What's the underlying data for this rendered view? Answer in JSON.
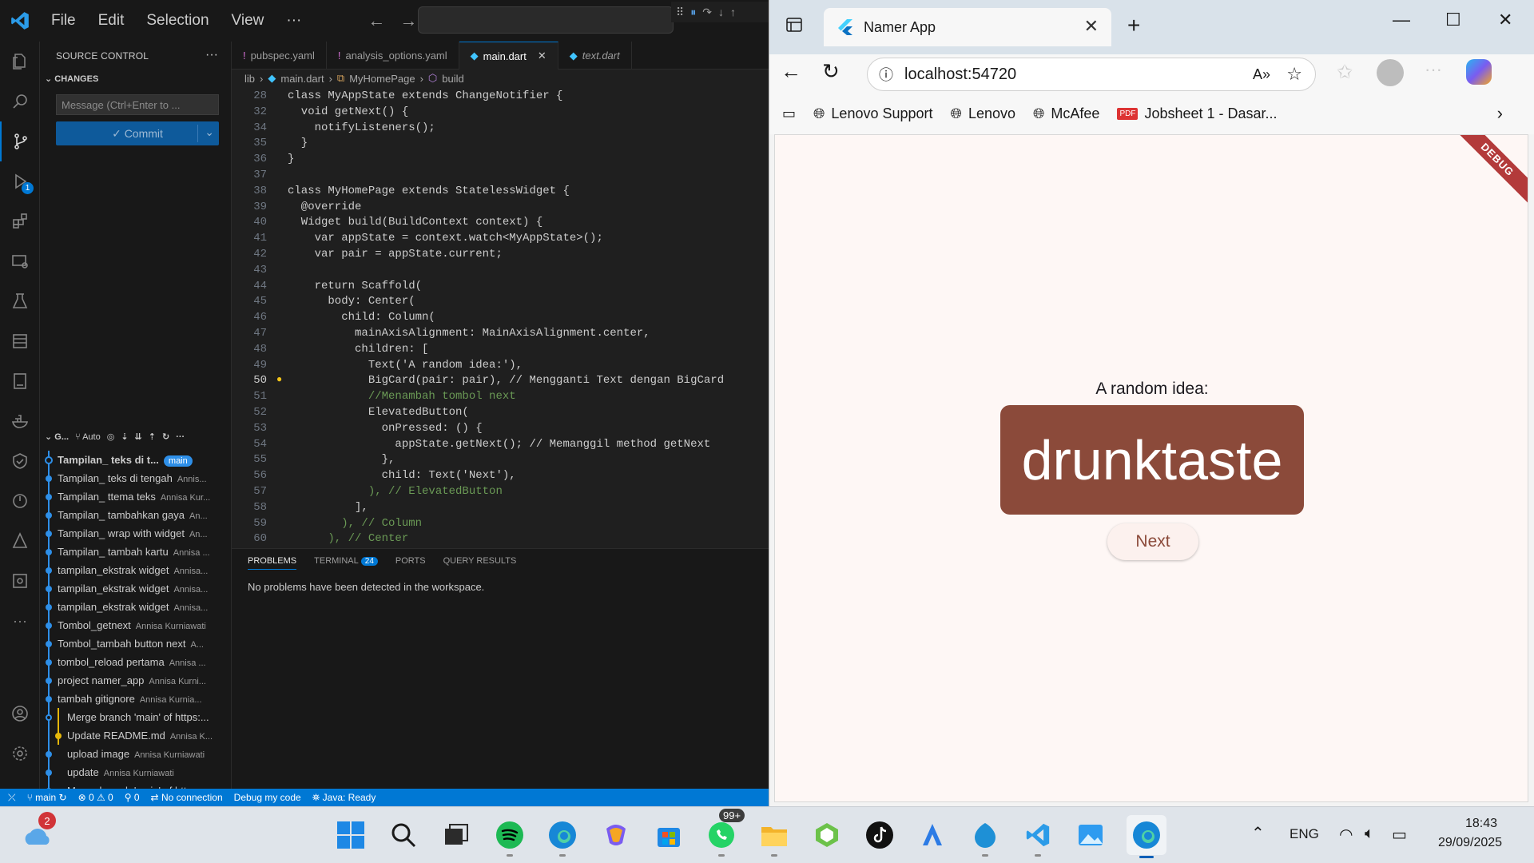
{
  "vscode": {
    "menu": [
      "File",
      "Edit",
      "Selection",
      "View",
      "···"
    ],
    "sidebar": {
      "title": "SOURCE CONTROL",
      "more": "···",
      "changes_header": "CHANGES",
      "commit_placeholder": "Message (Ctrl+Enter to ...",
      "commit_label": "✓ Commit",
      "graph_header": "G...",
      "graph_auto": "Auto",
      "branch_badge": "main",
      "commits": [
        {
          "msg": "Tampilan_ teks di t...",
          "author": ""
        },
        {
          "msg": "Tampilan_ teks di tengah",
          "author": "Annis..."
        },
        {
          "msg": "Tampilan_ ttema teks",
          "author": "Annisa Kur..."
        },
        {
          "msg": "Tampilan_ tambahkan gaya",
          "author": "An..."
        },
        {
          "msg": "Tampilan_ wrap with widget",
          "author": "An..."
        },
        {
          "msg": "Tampilan_ tambah kartu",
          "author": "Annisa ..."
        },
        {
          "msg": "tampilan_ekstrak widget",
          "author": "Annisa..."
        },
        {
          "msg": "tampilan_ekstrak widget",
          "author": "Annisa..."
        },
        {
          "msg": "tampilan_ekstrak widget",
          "author": "Annisa..."
        },
        {
          "msg": "Tombol_getnext",
          "author": "Annisa Kurniawati"
        },
        {
          "msg": "Tombol_tambah button next",
          "author": "A..."
        },
        {
          "msg": "tombol_reload pertama",
          "author": "Annisa ..."
        },
        {
          "msg": "project namer_app",
          "author": "Annisa Kurni..."
        },
        {
          "msg": "tambah gitignore",
          "author": "Annisa Kurnia..."
        },
        {
          "msg": "Merge branch 'main' of https:...",
          "author": ""
        },
        {
          "msg": "Update README.md",
          "author": "Annisa K..."
        },
        {
          "msg": "upload image",
          "author": "Annisa Kurniawati"
        },
        {
          "msg": "update",
          "author": "Annisa Kurniawati"
        },
        {
          "msg": "Merge branch 'main' of https...",
          "author": ""
        }
      ]
    },
    "tabs": [
      {
        "icon": "!",
        "label": "pubspec.yaml"
      },
      {
        "icon": "!",
        "label": "analysis_options.yaml"
      },
      {
        "icon": "◆",
        "label": "main.dart"
      },
      {
        "icon": "◆",
        "label": "text.dart"
      }
    ],
    "breadcrumb": [
      "lib",
      "main.dart",
      "MyHomePage",
      "build"
    ],
    "code_lines": [
      {
        "n": "28",
        "t": "class MyAppState extends ChangeNotifier {"
      },
      {
        "n": "32",
        "t": "  void getNext() {"
      },
      {
        "n": "34",
        "t": "    notifyListeners();"
      },
      {
        "n": "35",
        "t": "  }"
      },
      {
        "n": "36",
        "t": "}"
      },
      {
        "n": "37",
        "t": ""
      },
      {
        "n": "38",
        "t": "class MyHomePage extends StatelessWidget {"
      },
      {
        "n": "39",
        "t": "  @override"
      },
      {
        "n": "40",
        "t": "  Widget build(BuildContext context) {"
      },
      {
        "n": "41",
        "t": "    var appState = context.watch<MyAppState>();"
      },
      {
        "n": "42",
        "t": "    var pair = appState.current;"
      },
      {
        "n": "43",
        "t": ""
      },
      {
        "n": "44",
        "t": "    return Scaffold("
      },
      {
        "n": "45",
        "t": "      body: Center("
      },
      {
        "n": "46",
        "t": "        child: Column("
      },
      {
        "n": "47",
        "t": "          mainAxisAlignment: MainAxisAlignment.center,"
      },
      {
        "n": "48",
        "t": "          children: ["
      },
      {
        "n": "49",
        "t": "            Text('A random idea:'),"
      },
      {
        "n": "50",
        "t": "            BigCard(pair: pair), // Mengganti Text dengan BigCard"
      },
      {
        "n": "51",
        "t": "            //Menambah tombol next"
      },
      {
        "n": "52",
        "t": "            ElevatedButton("
      },
      {
        "n": "53",
        "t": "              onPressed: () {"
      },
      {
        "n": "54",
        "t": "                appState.getNext(); // Memanggil method getNext"
      },
      {
        "n": "55",
        "t": "              },"
      },
      {
        "n": "56",
        "t": "              child: Text('Next'),"
      },
      {
        "n": "57",
        "t": "            ), // ElevatedButton"
      },
      {
        "n": "58",
        "t": "          ],"
      },
      {
        "n": "59",
        "t": "        ), // Column"
      },
      {
        "n": "60",
        "t": "      ), // Center"
      }
    ],
    "panel": {
      "tabs": [
        "PROBLEMS",
        "TERMINAL",
        "PORTS",
        "QUERY RESULTS"
      ],
      "terminal_badge": "24",
      "message": "No problems have been detected in the workspace."
    },
    "status": {
      "branch": "main",
      "problems": "⊗ 0 ⚠ 0",
      "ports": "0",
      "connection": "No connection",
      "debug": "Debug my code",
      "java": "Java: Ready"
    },
    "debug_badge": "1"
  },
  "edge": {
    "tab_title": "Namer App",
    "url": "localhost:54720",
    "favorites": [
      "Lenovo Support",
      "Lenovo",
      "McAfee",
      "Jobsheet 1 - Dasar..."
    ],
    "app": {
      "debug_banner": "DEBUG",
      "label": "A random idea:",
      "word": "drunktaste",
      "next": "Next"
    }
  },
  "taskbar": {
    "weather_badge": "2",
    "whatsapp_badge": "99+",
    "lang": "ENG",
    "time": "18:43",
    "date": "29/09/2025"
  },
  "colors": {
    "accent": "#0078d4",
    "card": "#8b4a3a",
    "app_bg": "#fef7f5"
  }
}
